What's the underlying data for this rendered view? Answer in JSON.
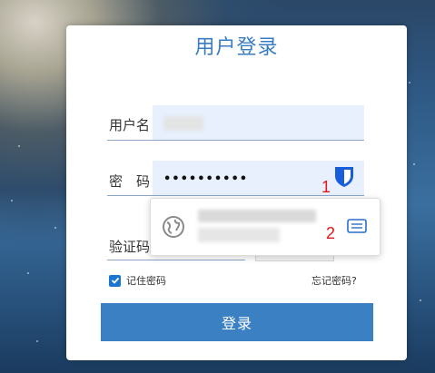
{
  "form": {
    "title": "用户登录",
    "username_label": "用户名",
    "password_label_1": "密",
    "password_label_2": "码",
    "password_value": "••••••••••",
    "captcha_label": "验证码",
    "remember_label": "记住密码",
    "remember_checked": true,
    "forgot_label": "忘记密码?",
    "login_label": "登录"
  },
  "annotations": {
    "marker_1": "1",
    "marker_2": "2"
  },
  "autofill_popup": {
    "icons": [
      "globe-icon",
      "fill-icon"
    ]
  },
  "colors": {
    "accent": "#3a80c3",
    "title": "#3a7cc0",
    "marker": "#e01818",
    "bitwarden": "#175ddc",
    "input_bg": "#e8f0fe"
  }
}
